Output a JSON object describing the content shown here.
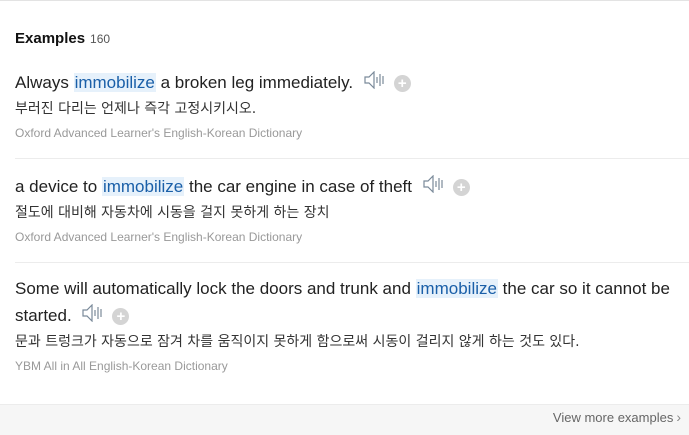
{
  "header": {
    "title": "Examples",
    "count": "160"
  },
  "examples": [
    {
      "pre": "Always ",
      "highlight": "immobilize",
      "post": " a broken leg immediately.",
      "translation": "부러진 다리는 언제나 즉각 고정시키시오.",
      "source": "Oxford Advanced Learner's English-Korean Dictionary"
    },
    {
      "pre": "a device to ",
      "highlight": "immobilize",
      "post": " the car engine in case of theft",
      "translation": "절도에 대비해 자동차에 시동을 걸지 못하게 하는 장치",
      "source": "Oxford Advanced Learner's English-Korean Dictionary"
    },
    {
      "pre": "Some will automatically lock the doors and trunk and ",
      "highlight": "immobilize",
      "post": " the car so it cannot be started.",
      "translation": "문과 트렁크가 자동으로 잠겨 차를 움직이지 못하게 함으로써 시동이 걸리지 않게 하는 것도 있다.",
      "source": "YBM All in All English-Korean Dictionary"
    }
  ],
  "icons": {
    "speaker": "speaker-icon",
    "add": "add-to-wordbook-icon",
    "chevron": "chevron-right-icon"
  },
  "plus_glyph": "+",
  "footer": {
    "more_label": "View more examples",
    "chevron": "›"
  },
  "colors": {
    "highlight_bg": "#e6f1fb",
    "source_text": "#999999"
  }
}
